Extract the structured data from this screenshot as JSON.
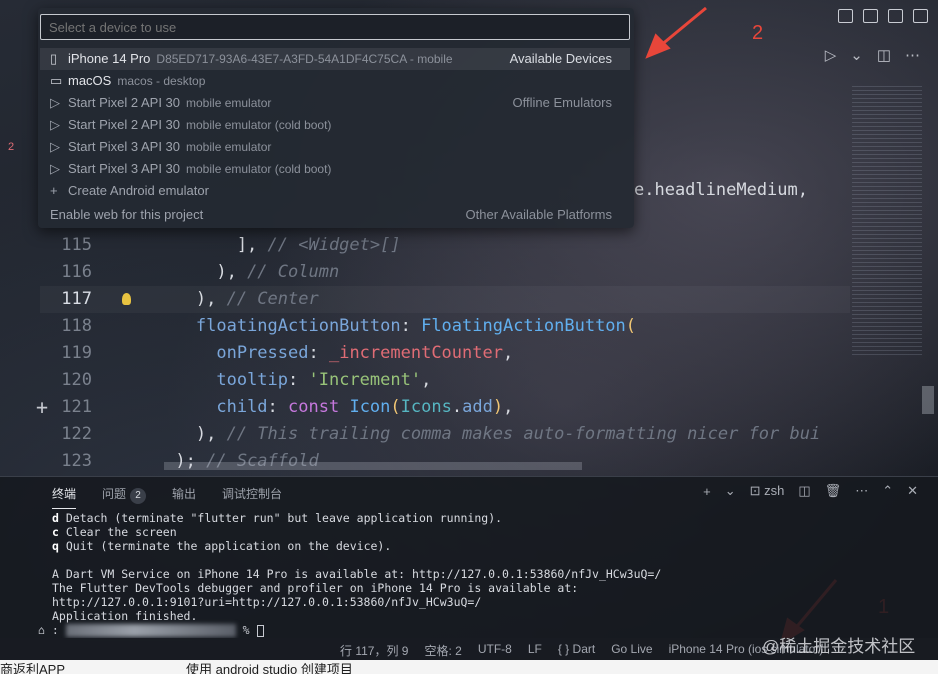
{
  "colors": {
    "accent": "#e8463a",
    "keyword": "#c678dd",
    "string": "#98c379",
    "type": "#61afef"
  },
  "quickpick": {
    "placeholder": "Select a device to use",
    "items": [
      {
        "icon": "phone-icon",
        "label": "iPhone 14 Pro",
        "desc": "D85ED717-93A6-43E7-A3FD-54A1DF4C75CA - mobile",
        "group": "Available Devices"
      },
      {
        "icon": "desktop-icon",
        "label": "macOS",
        "desc": "macos - desktop",
        "group": ""
      },
      {
        "icon": "play-icon",
        "label": "Start Pixel 2 API 30",
        "desc": "mobile emulator",
        "group": "Offline Emulators"
      },
      {
        "icon": "play-icon",
        "label": "Start Pixel 2 API 30",
        "desc": "mobile emulator (cold boot)",
        "group": ""
      },
      {
        "icon": "play-icon",
        "label": "Start Pixel 3 API 30",
        "desc": "mobile emulator",
        "group": ""
      },
      {
        "icon": "play-icon",
        "label": "Start Pixel 3 API 30",
        "desc": "mobile emulator (cold boot)",
        "group": ""
      },
      {
        "icon": "plus-icon",
        "label": "Create Android emulator",
        "desc": "",
        "group": ""
      },
      {
        "icon": "",
        "label": "Enable web for this project",
        "desc": "",
        "group": "Other Available Platforms"
      }
    ]
  },
  "gutter_marker": "2",
  "code_peek": "e.headlineMedium,",
  "code_lines": [
    {
      "num": "115",
      "parts": [
        [
          "w",
          "            ], "
        ],
        [
          "c",
          "// <Widget>[]"
        ]
      ]
    },
    {
      "num": "116",
      "parts": [
        [
          "w",
          "          ), "
        ],
        [
          "c",
          "// Column"
        ]
      ]
    },
    {
      "num": "117",
      "parts": [
        [
          "w",
          "        ), "
        ],
        [
          "c",
          "// Center"
        ]
      ]
    },
    {
      "num": "118",
      "parts": [
        [
          "w",
          "        "
        ],
        [
          "p",
          "floatingActionButton"
        ],
        [
          "w",
          ": "
        ],
        [
          "b",
          "FloatingActionButton"
        ],
        [
          "y",
          "("
        ]
      ]
    },
    {
      "num": "119",
      "parts": [
        [
          "w",
          "          "
        ],
        [
          "p",
          "onPressed"
        ],
        [
          "w",
          ": "
        ],
        [
          "v",
          "_incrementCounter"
        ],
        [
          "w",
          ","
        ]
      ]
    },
    {
      "num": "120",
      "parts": [
        [
          "w",
          "          "
        ],
        [
          "p",
          "tooltip"
        ],
        [
          "w",
          ": "
        ],
        [
          "g",
          "'Increment'"
        ],
        [
          "w",
          ","
        ]
      ]
    },
    {
      "num": "121",
      "parts": [
        [
          "w",
          "          "
        ],
        [
          "p",
          "child"
        ],
        [
          "w",
          ": "
        ],
        [
          "k",
          "const "
        ],
        [
          "b",
          "Icon"
        ],
        [
          "y",
          "("
        ],
        [
          "t",
          "Icons"
        ],
        [
          "w",
          "."
        ],
        [
          "p",
          "add"
        ],
        [
          "y",
          ")"
        ],
        [
          "w",
          ","
        ]
      ]
    },
    {
      "num": "122",
      "parts": [
        [
          "w",
          "        ), "
        ],
        [
          "c",
          "// This trailing comma makes auto-formatting nicer for bui"
        ]
      ]
    },
    {
      "num": "123",
      "parts": [
        [
          "w",
          "      ); "
        ],
        [
          "c",
          "// Scaffold"
        ]
      ]
    }
  ],
  "panel": {
    "tabs": [
      {
        "label": "终端"
      },
      {
        "label": "问题",
        "badge": "2"
      },
      {
        "label": "输出"
      },
      {
        "label": "调试控制台"
      }
    ],
    "shell": "zsh",
    "terminal_lines": [
      {
        "key": "d",
        "text": " Detach (terminate \"flutter run\" but leave application running)."
      },
      {
        "key": "c",
        "text": " Clear the screen"
      },
      {
        "key": "q",
        "text": " Quit (terminate the application on the device)."
      },
      {
        "key": "",
        "text": ""
      },
      {
        "key": "",
        "text": "A Dart VM Service on iPhone 14 Pro is available at: http://127.0.0.1:53860/nfJv_HCw3uQ=/"
      },
      {
        "key": "",
        "text": "The Flutter DevTools debugger and profiler on iPhone 14 Pro is available at:"
      },
      {
        "key": "",
        "text": "http://127.0.0.1:9101?uri=http://127.0.0.1:53860/nfJv_HCw3uQ=/"
      },
      {
        "key": "",
        "text": "Application finished."
      }
    ],
    "prompt_suffix": "% "
  },
  "statusbar": {
    "items": [
      "行 117，列 9",
      "空格: 2",
      "UTF-8",
      "LF",
      "{ } Dart",
      "Go Live",
      "iPhone 14 Pro (ios simulator)"
    ]
  },
  "annotations": {
    "one": "1",
    "two": "2"
  },
  "watermark": "@稀土掘金技术社区",
  "below_text": {
    "left": "商返利APP",
    "mid": "使用 android studio 创建项目"
  }
}
